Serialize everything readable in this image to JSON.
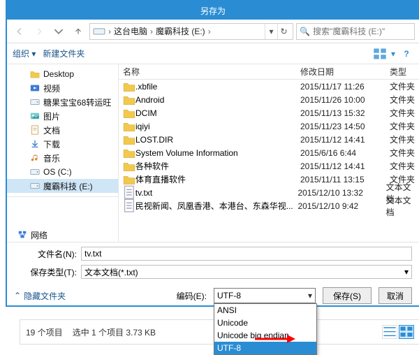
{
  "title": "另存为",
  "nav": {
    "segments": [
      "这台电脑",
      "魔霸科技 (E:)"
    ],
    "search_placeholder": "搜索\"魔霸科技 (E:)\""
  },
  "toolbar": {
    "organize": "组织 ▾",
    "new_folder": "新建文件夹"
  },
  "sidebar": {
    "items": [
      {
        "label": "Desktop",
        "icon": "folder"
      },
      {
        "label": "视频",
        "icon": "video"
      },
      {
        "label": "糖果宝宝68转运旺",
        "icon": "drive"
      },
      {
        "label": "图片",
        "icon": "picture"
      },
      {
        "label": "文档",
        "icon": "doc"
      },
      {
        "label": "下载",
        "icon": "download"
      },
      {
        "label": "音乐",
        "icon": "music"
      },
      {
        "label": "OS (C:)",
        "icon": "drive-c"
      },
      {
        "label": "魔霸科技 (E:)",
        "icon": "drive-e",
        "selected": true
      }
    ],
    "network": "网络"
  },
  "columns": {
    "name": "名称",
    "modified": "修改日期",
    "type": "类型"
  },
  "files": [
    {
      "name": ".xbfile",
      "date": "2015/11/17 11:26",
      "type": "文件夹",
      "icon": "folder"
    },
    {
      "name": "Android",
      "date": "2015/11/26 10:00",
      "type": "文件夹",
      "icon": "folder"
    },
    {
      "name": "DCIM",
      "date": "2015/11/13 15:32",
      "type": "文件夹",
      "icon": "folder"
    },
    {
      "name": "iqiyi",
      "date": "2015/11/23 14:50",
      "type": "文件夹",
      "icon": "folder"
    },
    {
      "name": "LOST.DIR",
      "date": "2015/11/12 14:41",
      "type": "文件夹",
      "icon": "folder"
    },
    {
      "name": "System Volume Information",
      "date": "2015/6/16 6:44",
      "type": "文件夹",
      "icon": "folder"
    },
    {
      "name": "各种软件",
      "date": "2015/11/12 14:41",
      "type": "文件夹",
      "icon": "folder"
    },
    {
      "name": "体育直播软件",
      "date": "2015/11/11 13:15",
      "type": "文件夹",
      "icon": "folder"
    },
    {
      "name": "tv.txt",
      "date": "2015/12/10 13:32",
      "type": "文本文档",
      "icon": "txt"
    },
    {
      "name": "民视新闻、凤凰香港、本港台、东森华视...",
      "date": "2015/12/10 9:42",
      "type": "文本文档",
      "icon": "txt"
    }
  ],
  "fields": {
    "filename_label": "文件名(N):",
    "filename_value": "tv.txt",
    "filetype_label": "保存类型(T):",
    "filetype_value": "文本文档(*.txt)"
  },
  "actions": {
    "hide_folders": "隐藏文件夹",
    "encoding_label": "编码(E):",
    "encoding_value": "UTF-8",
    "save": "保存(S)",
    "cancel": "取消"
  },
  "encoding_options": [
    "ANSI",
    "Unicode",
    "Unicode big endian",
    "UTF-8"
  ],
  "encoding_selected_index": 3,
  "statusbar": {
    "count": "19 个项目",
    "selection": "选中 1 个项目  3.73 KB"
  }
}
